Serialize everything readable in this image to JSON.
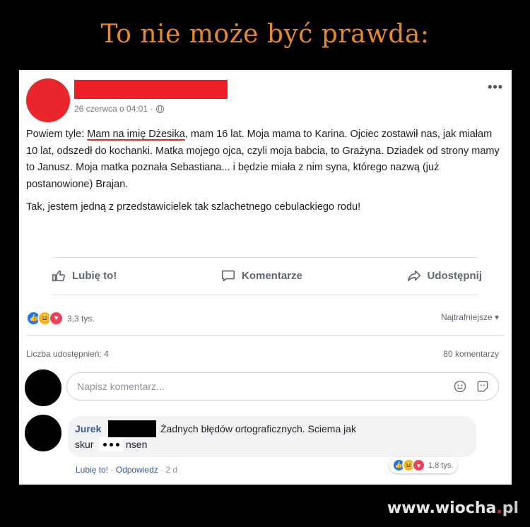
{
  "meme": {
    "title": "To nie może być prawda:",
    "watermark": {
      "domain": "www.wiocha",
      "dot": ".",
      "tld": "pl"
    }
  },
  "post": {
    "timestamp": "26 czerwca o 04:01 ·",
    "more_label": "•••",
    "paragraphs": [
      {
        "before": "Powiem tyle: ",
        "underlined": "Mam na imię Dżesika",
        "after": ", mam 16 lat. Moja mama to Karina. Ojciec zostawił nas, jak miałam 10 lat, odszedł do kochanki. Matka mojego ojca, czyli moja babcia, to Grażyna. Dziadek od strony mamy to Janusz. Moja matka poznała Sebastiana... i będzie miała z nim syna, którego nazwą (już postanowione) Brajan."
      },
      {
        "text": "Tak, jestem jedną z przedstawicielek tak szlachetnego cebulackiego rodu!"
      }
    ],
    "actions": {
      "like": "Lubię to!",
      "comment": "Komentarze",
      "share": "Udostępnij"
    },
    "reactions_count": "3,3 tys.",
    "sort_label": "Najtrafniejsze ▾",
    "shares_label": "Liczba udostępnień: 4",
    "comments_label": "80 komentarzy",
    "comment_placeholder": "Napisz komentarz..."
  },
  "comment": {
    "author": "Jurek",
    "text_line1": "Żadnych błędów ortograficznych. Sciema jak",
    "text_line2_a": "skur",
    "text_line2_b": "nsen",
    "like": "Lubię to!",
    "sep": "·",
    "reply": "Odpowiedz",
    "age": "2 d",
    "reactions_count": "1,8 tys."
  },
  "colors": {
    "title": "#e8892a",
    "redaction_red": "#ec1f27",
    "fb_blue": "#1877f2",
    "link": "#385898"
  }
}
